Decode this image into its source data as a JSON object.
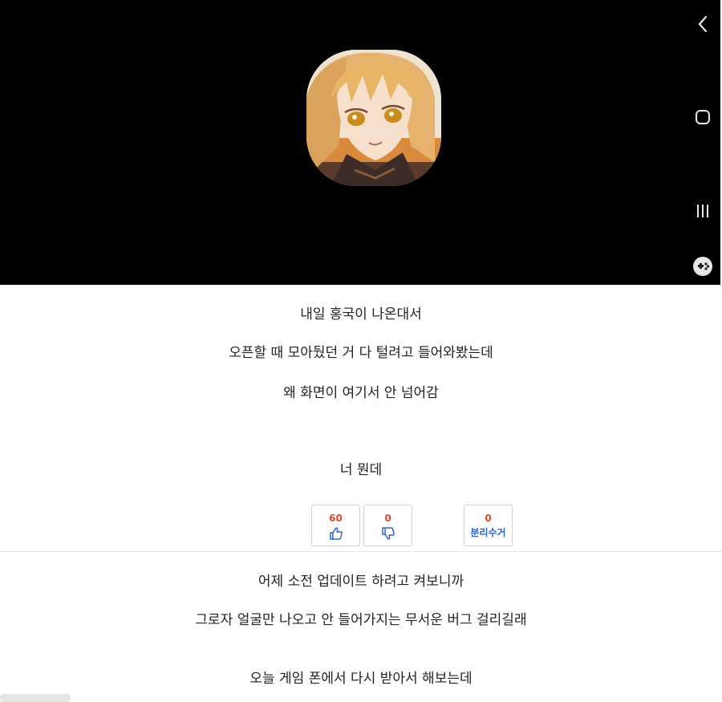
{
  "post": {
    "lines": [
      "내일 홍국이 나온대서",
      "오픈할 때 모아뒀던 거 다 털려고 들어와봤는데",
      "왜 화면이 여기서 안 넘어감",
      "너 뭔데"
    ]
  },
  "votes": {
    "up_count": "60",
    "down_count": "0",
    "recycle_count": "0",
    "recycle_label": "분리수거"
  },
  "comment": {
    "lines": [
      "어제 소전 업데이트 하려고 켜보니까",
      "그로자 얼굴만 나오고 안 들어가지는 무서운 버그 걸리길래",
      "오늘 게임 폰에서 다시 받아서 해보는데"
    ]
  },
  "colors": {
    "screen_bg": "#000000",
    "vote_count": "#e04a2f",
    "vote_icon": "#2f63c7",
    "text": "#222222"
  },
  "icons": {
    "nav_back": "chevron-left-icon",
    "nav_home": "home-icon",
    "nav_recent": "recent-apps-icon",
    "nav_game": "gamepad-icon",
    "vote_up": "thumbs-up-icon",
    "vote_down": "thumbs-down-icon"
  }
}
